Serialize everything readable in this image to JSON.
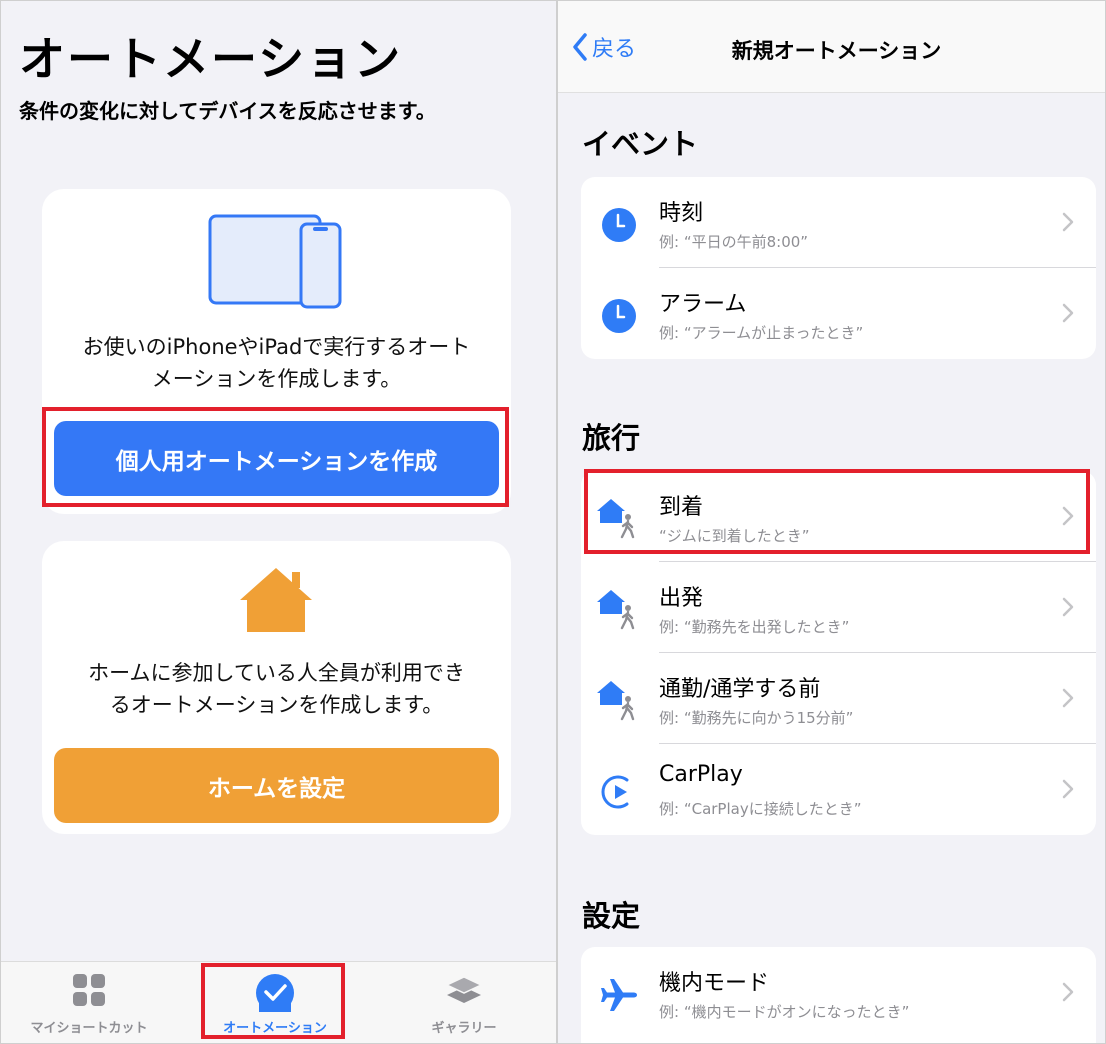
{
  "left": {
    "title": "オートメーション",
    "subtitle": "条件の変化に対してデバイスを反応させます。",
    "personal_card": {
      "description_line1": "お使いのiPhoneやiPadで実行するオート",
      "description_line2": "メーションを作成します。",
      "button_label": "個人用オートメーションを作成"
    },
    "home_card": {
      "description_line1": "ホームに参加している人全員が利用でき",
      "description_line2": "るオートメーションを作成します。",
      "button_label": "ホームを設定"
    },
    "tabs": [
      {
        "label": "マイショートカット",
        "icon": "grid-icon"
      },
      {
        "label": "オートメーション",
        "icon": "checkmark-circle-icon",
        "selected": true
      },
      {
        "label": "ギャラリー",
        "icon": "layers-icon"
      }
    ]
  },
  "right": {
    "back_label": "戻る",
    "nav_title": "新規オートメーション",
    "sections": [
      {
        "title": "イベント",
        "rows": [
          {
            "title": "時刻",
            "subtitle": "例: “平日の午前8:00”",
            "icon": "clock-icon"
          },
          {
            "title": "アラーム",
            "subtitle": "例: “アラームが止まったとき”",
            "icon": "clock-icon"
          }
        ]
      },
      {
        "title": "旅行",
        "rows": [
          {
            "title": "到着",
            "subtitle": "“ジムに到着したとき”",
            "icon": "house-walker-icon"
          },
          {
            "title": "出発",
            "subtitle": "例: “勤務先を出発したとき”",
            "icon": "house-walker-icon"
          },
          {
            "title": "通勤/通学する前",
            "subtitle": "例: “勤務先に向かう15分前”",
            "icon": "house-walker-icon"
          },
          {
            "title": "CarPlay",
            "subtitle": "例: “CarPlayに接続したとき”",
            "icon": "carplay-icon"
          }
        ]
      },
      {
        "title": "設定",
        "rows": [
          {
            "title": "機内モード",
            "subtitle": "例: “機内モードがオンになったとき”",
            "icon": "airplane-icon"
          }
        ]
      }
    ]
  },
  "colors": {
    "accent_blue": "#3478f6",
    "home_orange": "#f0a036",
    "highlight_red": "#e3202c"
  }
}
